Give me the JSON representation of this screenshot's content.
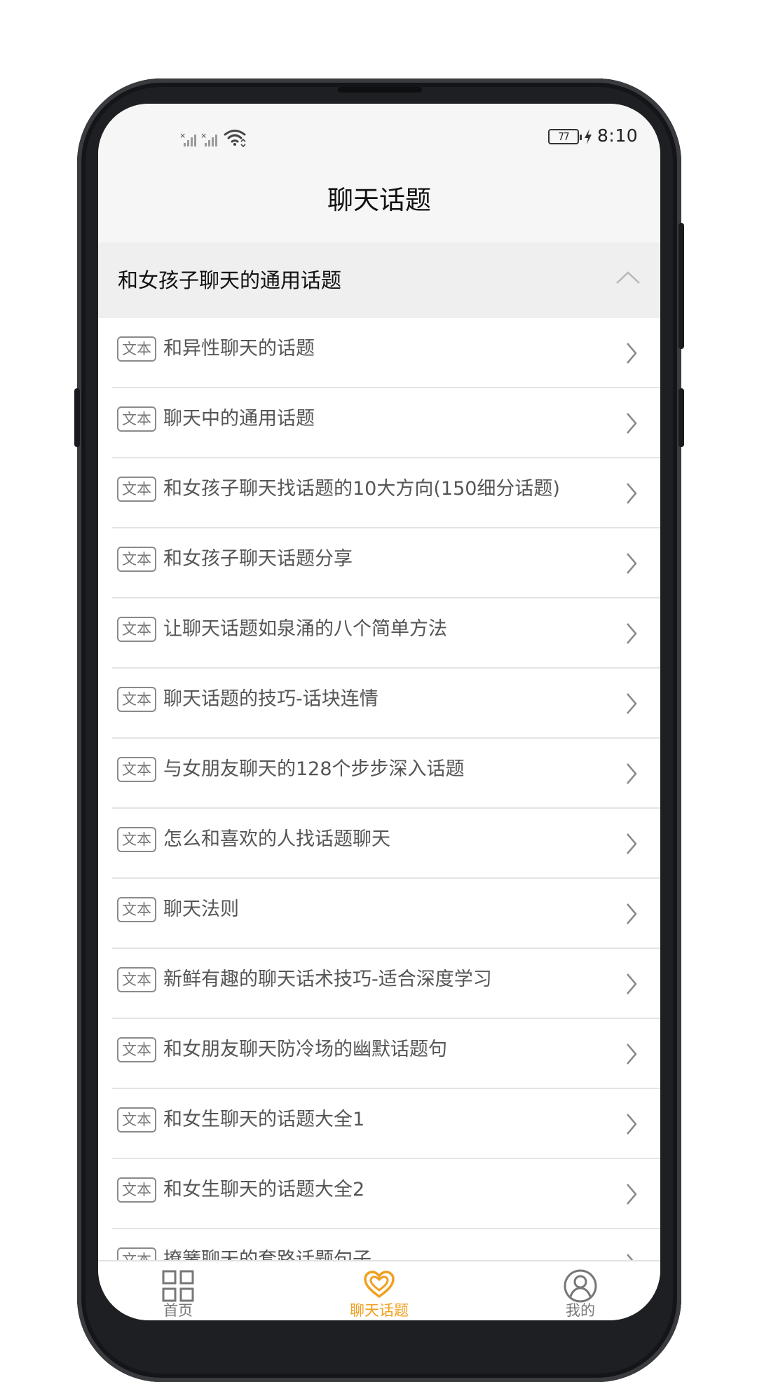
{
  "status_bar": {
    "battery_level": "77",
    "time": "8:10",
    "icons": [
      "signal-no-sim-icon",
      "signal-no-sim-icon",
      "wifi-icon",
      "battery-icon",
      "charging-icon"
    ]
  },
  "header": {
    "title": "聊天话题"
  },
  "section": {
    "title": "和女孩子聊天的通用话题",
    "expanded": true
  },
  "list": {
    "items": [
      {
        "tag": "文本",
        "label": "和异性聊天的话题"
      },
      {
        "tag": "文本",
        "label": "聊天中的通用话题"
      },
      {
        "tag": "文本",
        "label": "和女孩子聊天找话题的10大方向(150细分话题)"
      },
      {
        "tag": "文本",
        "label": "和女孩子聊天话题分享"
      },
      {
        "tag": "文本",
        "label": "让聊天话题如泉涌的八个简单方法"
      },
      {
        "tag": "文本",
        "label": "聊天话题的技巧-话块连情"
      },
      {
        "tag": "文本",
        "label": "与女朋友聊天的128个步步深入话题"
      },
      {
        "tag": "文本",
        "label": "怎么和喜欢的人找话题聊天"
      },
      {
        "tag": "文本",
        "label": "聊天法则"
      },
      {
        "tag": "文本",
        "label": "新鲜有趣的聊天话术技巧-适合深度学习"
      },
      {
        "tag": "文本",
        "label": "和女朋友聊天防冷场的幽默话题句"
      },
      {
        "tag": "文本",
        "label": "和女生聊天的话题大全1"
      },
      {
        "tag": "文本",
        "label": "和女生聊天的话题大全2"
      },
      {
        "tag": "文本",
        "label": "撩簧聊天的套路话题句子"
      }
    ]
  },
  "tab_bar": {
    "tabs": [
      {
        "label": "首页",
        "icon": "grid-icon",
        "active": false
      },
      {
        "label": "聊天话题",
        "icon": "heart-chat-icon",
        "active": true
      },
      {
        "label": "我的",
        "icon": "user-icon",
        "active": false
      }
    ]
  },
  "colors": {
    "accent": "#F0A020",
    "inactive": "#777777",
    "text_primary": "#111111",
    "text_secondary": "#555555"
  }
}
